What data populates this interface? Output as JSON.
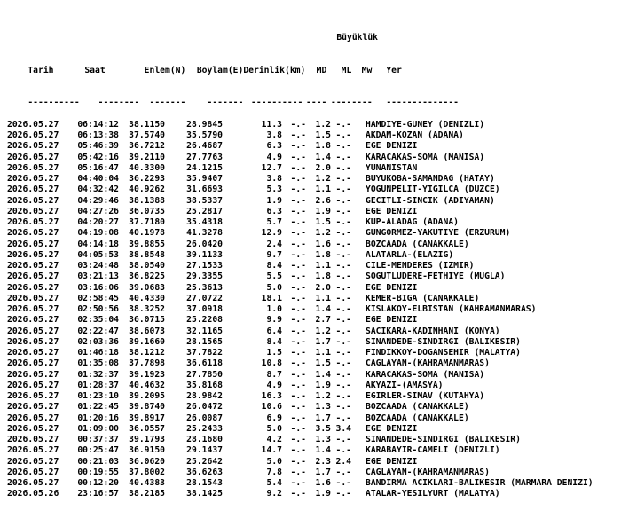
{
  "title": "Büyüklük",
  "headers": {
    "tarih": "Tarih",
    "saat": "Saat",
    "enlem": "Enlem(N)",
    "boylam": "Boylam(E)",
    "derinlik": "Derinlik(km)",
    "md": "MD",
    "ml": "ML",
    "mw": "Mw",
    "yer": "Yer"
  },
  "separators": {
    "tarih": "----------",
    "saat": "--------",
    "enlem": "-------",
    "boylam": "-------",
    "derinlik": "----------",
    "md": "----",
    "ml": "----",
    "mw": "----",
    "yer": "--------------"
  },
  "rows": [
    {
      "tarih": "2026.05.27",
      "saat": "06:14:12",
      "enlem": "38.1150",
      "boylam": "28.9845",
      "derinlik": "11.3",
      "md": "-.-",
      "ml": "1.2",
      "mw": "-.-",
      "yer": "HAMDIYE-GUNEY (DENIZLI)"
    },
    {
      "tarih": "2026.05.27",
      "saat": "06:13:38",
      "enlem": "37.5740",
      "boylam": "35.5790",
      "derinlik": "3.8",
      "md": "-.-",
      "ml": "1.5",
      "mw": "-.-",
      "yer": "AKDAM-KOZAN (ADANA)"
    },
    {
      "tarih": "2026.05.27",
      "saat": "05:46:39",
      "enlem": "36.7212",
      "boylam": "26.4687",
      "derinlik": "6.3",
      "md": "-.-",
      "ml": "1.8",
      "mw": "-.-",
      "yer": "EGE DENIZI"
    },
    {
      "tarih": "2026.05.27",
      "saat": "05:42:16",
      "enlem": "39.2110",
      "boylam": "27.7763",
      "derinlik": "4.9",
      "md": "-.-",
      "ml": "1.4",
      "mw": "-.-",
      "yer": "KARACAKAS-SOMA (MANISA)"
    },
    {
      "tarih": "2026.05.27",
      "saat": "05:16:47",
      "enlem": "40.3300",
      "boylam": "24.1215",
      "derinlik": "12.7",
      "md": "-.-",
      "ml": "2.0",
      "mw": "-.-",
      "yer": "YUNANISTAN"
    },
    {
      "tarih": "2026.05.27",
      "saat": "04:40:04",
      "enlem": "36.2293",
      "boylam": "35.9407",
      "derinlik": "3.8",
      "md": "-.-",
      "ml": "1.2",
      "mw": "-.-",
      "yer": "BUYUKOBA-SAMANDAG (HATAY)"
    },
    {
      "tarih": "2026.05.27",
      "saat": "04:32:42",
      "enlem": "40.9262",
      "boylam": "31.6693",
      "derinlik": "5.3",
      "md": "-.-",
      "ml": "1.1",
      "mw": "-.-",
      "yer": "YOGUNPELIT-YIGILCA (DUZCE)"
    },
    {
      "tarih": "2026.05.27",
      "saat": "04:29:46",
      "enlem": "38.1388",
      "boylam": "38.5337",
      "derinlik": "1.9",
      "md": "-.-",
      "ml": "2.6",
      "mw": "-.-",
      "yer": "GECITLI-SINCIK (ADIYAMAN)"
    },
    {
      "tarih": "2026.05.27",
      "saat": "04:27:26",
      "enlem": "36.0735",
      "boylam": "25.2817",
      "derinlik": "6.3",
      "md": "-.-",
      "ml": "1.9",
      "mw": "-.-",
      "yer": "EGE DENIZI"
    },
    {
      "tarih": "2026.05.27",
      "saat": "04:20:27",
      "enlem": "37.7180",
      "boylam": "35.4318",
      "derinlik": "5.7",
      "md": "-.-",
      "ml": "1.5",
      "mw": "-.-",
      "yer": "KUP-ALADAG (ADANA)"
    },
    {
      "tarih": "2026.05.27",
      "saat": "04:19:08",
      "enlem": "40.1978",
      "boylam": "41.3278",
      "derinlik": "12.9",
      "md": "-.-",
      "ml": "1.2",
      "mw": "-.-",
      "yer": "GUNGORMEZ-YAKUTIYE (ERZURUM)"
    },
    {
      "tarih": "2026.05.27",
      "saat": "04:14:18",
      "enlem": "39.8855",
      "boylam": "26.0420",
      "derinlik": "2.4",
      "md": "-.-",
      "ml": "1.6",
      "mw": "-.-",
      "yer": "BOZCAADA (CANAKKALE)"
    },
    {
      "tarih": "2026.05.27",
      "saat": "04:05:53",
      "enlem": "38.8548",
      "boylam": "39.1133",
      "derinlik": "9.7",
      "md": "-.-",
      "ml": "1.8",
      "mw": "-.-",
      "yer": "ALATARLA-(ELAZIG)"
    },
    {
      "tarih": "2026.05.27",
      "saat": "03:24:48",
      "enlem": "38.0540",
      "boylam": "27.1533",
      "derinlik": "8.4",
      "md": "-.-",
      "ml": "1.1",
      "mw": "-.-",
      "yer": "CILE-MENDERES (IZMIR)"
    },
    {
      "tarih": "2026.05.27",
      "saat": "03:21:13",
      "enlem": "36.8225",
      "boylam": "29.3355",
      "derinlik": "5.5",
      "md": "-.-",
      "ml": "1.8",
      "mw": "-.-",
      "yer": "SOGUTLUDERE-FETHIYE (MUGLA)"
    },
    {
      "tarih": "2026.05.27",
      "saat": "03:16:06",
      "enlem": "39.0683",
      "boylam": "25.3613",
      "derinlik": "5.0",
      "md": "-.-",
      "ml": "2.0",
      "mw": "-.-",
      "yer": "EGE DENIZI"
    },
    {
      "tarih": "2026.05.27",
      "saat": "02:58:45",
      "enlem": "40.4330",
      "boylam": "27.0722",
      "derinlik": "18.1",
      "md": "-.-",
      "ml": "1.1",
      "mw": "-.-",
      "yer": "KEMER-BIGA (CANAKKALE)"
    },
    {
      "tarih": "2026.05.27",
      "saat": "02:50:56",
      "enlem": "38.3252",
      "boylam": "37.0918",
      "derinlik": "1.0",
      "md": "-.-",
      "ml": "1.4",
      "mw": "-.-",
      "yer": "KISLAKOY-ELBISTAN (KAHRAMANMARAS)"
    },
    {
      "tarih": "2026.05.27",
      "saat": "02:35:04",
      "enlem": "36.0715",
      "boylam": "25.2208",
      "derinlik": "9.9",
      "md": "-.-",
      "ml": "2.7",
      "mw": "-.-",
      "yer": "EGE DENIZI"
    },
    {
      "tarih": "2026.05.27",
      "saat": "02:22:47",
      "enlem": "38.6073",
      "boylam": "32.1165",
      "derinlik": "6.4",
      "md": "-.-",
      "ml": "1.2",
      "mw": "-.-",
      "yer": "SACIKARA-KADINHANI (KONYA)"
    },
    {
      "tarih": "2026.05.27",
      "saat": "02:03:36",
      "enlem": "39.1660",
      "boylam": "28.1565",
      "derinlik": "8.4",
      "md": "-.-",
      "ml": "1.7",
      "mw": "-.-",
      "yer": "SINANDEDE-SINDIRGI (BALIKESIR)"
    },
    {
      "tarih": "2026.05.27",
      "saat": "01:46:18",
      "enlem": "38.1212",
      "boylam": "37.7822",
      "derinlik": "1.5",
      "md": "-.-",
      "ml": "1.1",
      "mw": "-.-",
      "yer": "FINDIKKOY-DOGANSEHIR (MALATYA)"
    },
    {
      "tarih": "2026.05.27",
      "saat": "01:35:08",
      "enlem": "37.7898",
      "boylam": "36.6118",
      "derinlik": "10.8",
      "md": "-.-",
      "ml": "1.5",
      "mw": "-.-",
      "yer": "CAGLAYAN-(KAHRAMANMARAS)"
    },
    {
      "tarih": "2026.05.27",
      "saat": "01:32:37",
      "enlem": "39.1923",
      "boylam": "27.7850",
      "derinlik": "8.7",
      "md": "-.-",
      "ml": "1.4",
      "mw": "-.-",
      "yer": "KARACAKAS-SOMA (MANISA)"
    },
    {
      "tarih": "2026.05.27",
      "saat": "01:28:37",
      "enlem": "40.4632",
      "boylam": "35.8168",
      "derinlik": "4.9",
      "md": "-.-",
      "ml": "1.9",
      "mw": "-.-",
      "yer": "AKYAZI-(AMASYA)"
    },
    {
      "tarih": "2026.05.27",
      "saat": "01:23:10",
      "enlem": "39.2095",
      "boylam": "28.9842",
      "derinlik": "16.3",
      "md": "-.-",
      "ml": "1.2",
      "mw": "-.-",
      "yer": "EGIRLER-SIMAV (KUTAHYA)"
    },
    {
      "tarih": "2026.05.27",
      "saat": "01:22:45",
      "enlem": "39.8740",
      "boylam": "26.0472",
      "derinlik": "10.6",
      "md": "-.-",
      "ml": "1.3",
      "mw": "-.-",
      "yer": "BOZCAADA (CANAKKALE)"
    },
    {
      "tarih": "2026.05.27",
      "saat": "01:20:16",
      "enlem": "39.8917",
      "boylam": "26.0087",
      "derinlik": "6.9",
      "md": "-.-",
      "ml": "1.7",
      "mw": "-.-",
      "yer": "BOZCAADA (CANAKKALE)"
    },
    {
      "tarih": "2026.05.27",
      "saat": "01:09:00",
      "enlem": "36.0557",
      "boylam": "25.2433",
      "derinlik": "5.0",
      "md": "-.-",
      "ml": "3.5",
      "mw": "3.4",
      "yer": "EGE DENIZI"
    },
    {
      "tarih": "2026.05.27",
      "saat": "00:37:37",
      "enlem": "39.1793",
      "boylam": "28.1680",
      "derinlik": "4.2",
      "md": "-.-",
      "ml": "1.3",
      "mw": "-.-",
      "yer": "SINANDEDE-SINDIRGI (BALIKESIR)"
    },
    {
      "tarih": "2026.05.27",
      "saat": "00:25:47",
      "enlem": "36.9150",
      "boylam": "29.1437",
      "derinlik": "14.7",
      "md": "-.-",
      "ml": "1.4",
      "mw": "-.-",
      "yer": "KARABAYIR-CAMELI (DENIZLI)"
    },
    {
      "tarih": "2026.05.27",
      "saat": "00:21:03",
      "enlem": "36.0620",
      "boylam": "25.2642",
      "derinlik": "5.0",
      "md": "-.-",
      "ml": "2.3",
      "mw": "2.4",
      "yer": "EGE DENIZI"
    },
    {
      "tarih": "2026.05.27",
      "saat": "00:19:55",
      "enlem": "37.8002",
      "boylam": "36.6263",
      "derinlik": "7.8",
      "md": "-.-",
      "ml": "1.7",
      "mw": "-.-",
      "yer": "CAGLAYAN-(KAHRAMANMARAS)"
    },
    {
      "tarih": "2026.05.27",
      "saat": "00:12:20",
      "enlem": "40.4383",
      "boylam": "28.1543",
      "derinlik": "5.4",
      "md": "-.-",
      "ml": "1.6",
      "mw": "-.-",
      "yer": "BANDIRMA ACIKLARI-BALIKESIR (MARMARA DENIZI)"
    },
    {
      "tarih": "2026.05.26",
      "saat": "23:16:57",
      "enlem": "38.2185",
      "boylam": "38.1425",
      "derinlik": "9.2",
      "md": "-.-",
      "ml": "1.9",
      "mw": "-.-",
      "yer": "ATALAR-YESILYURT (MALATYA)"
    }
  ]
}
